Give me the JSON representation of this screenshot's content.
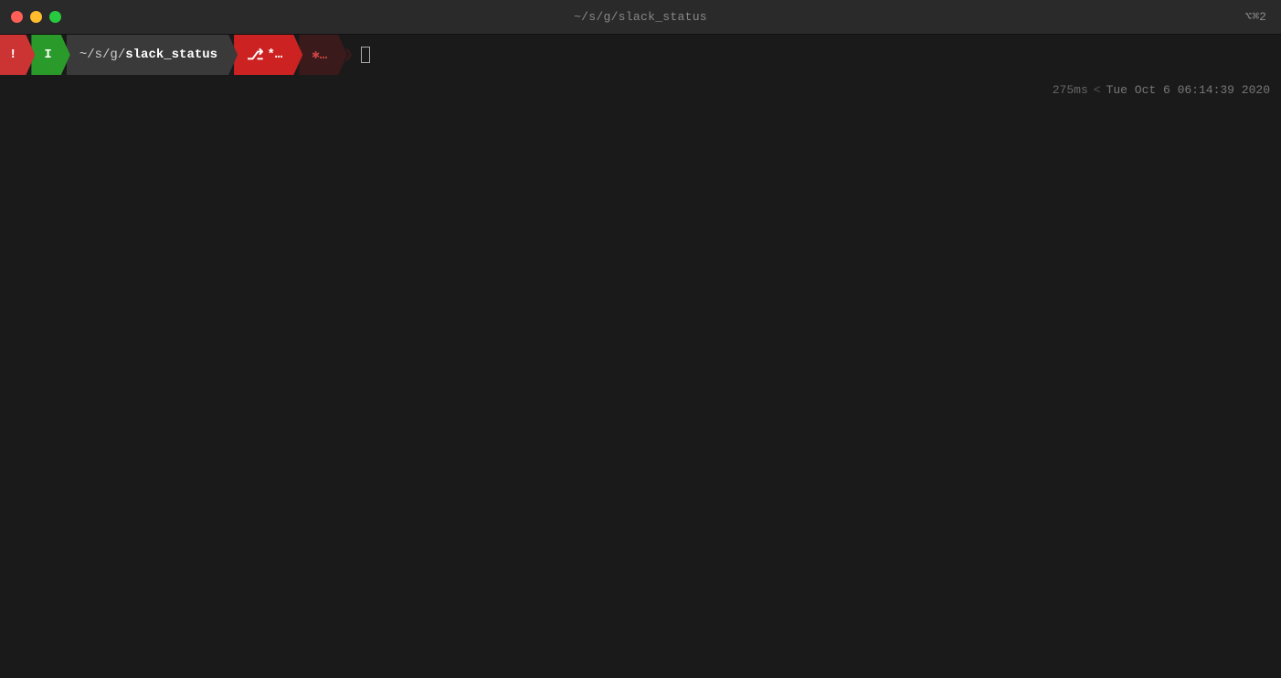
{
  "titlebar": {
    "title": "~/s/g/slack_status",
    "shortcut": "⌥⌘2"
  },
  "prompt": {
    "exclamation": "!",
    "vim_mode": "I",
    "path_prefix": "~/s/g/",
    "path_bold": "slack_status",
    "git_icon": "⌥",
    "git_branch": "*…",
    "cursor": ""
  },
  "status": {
    "duration": "275ms",
    "separator": "<",
    "datetime": "Tue Oct  6 06:14:39 2020"
  }
}
